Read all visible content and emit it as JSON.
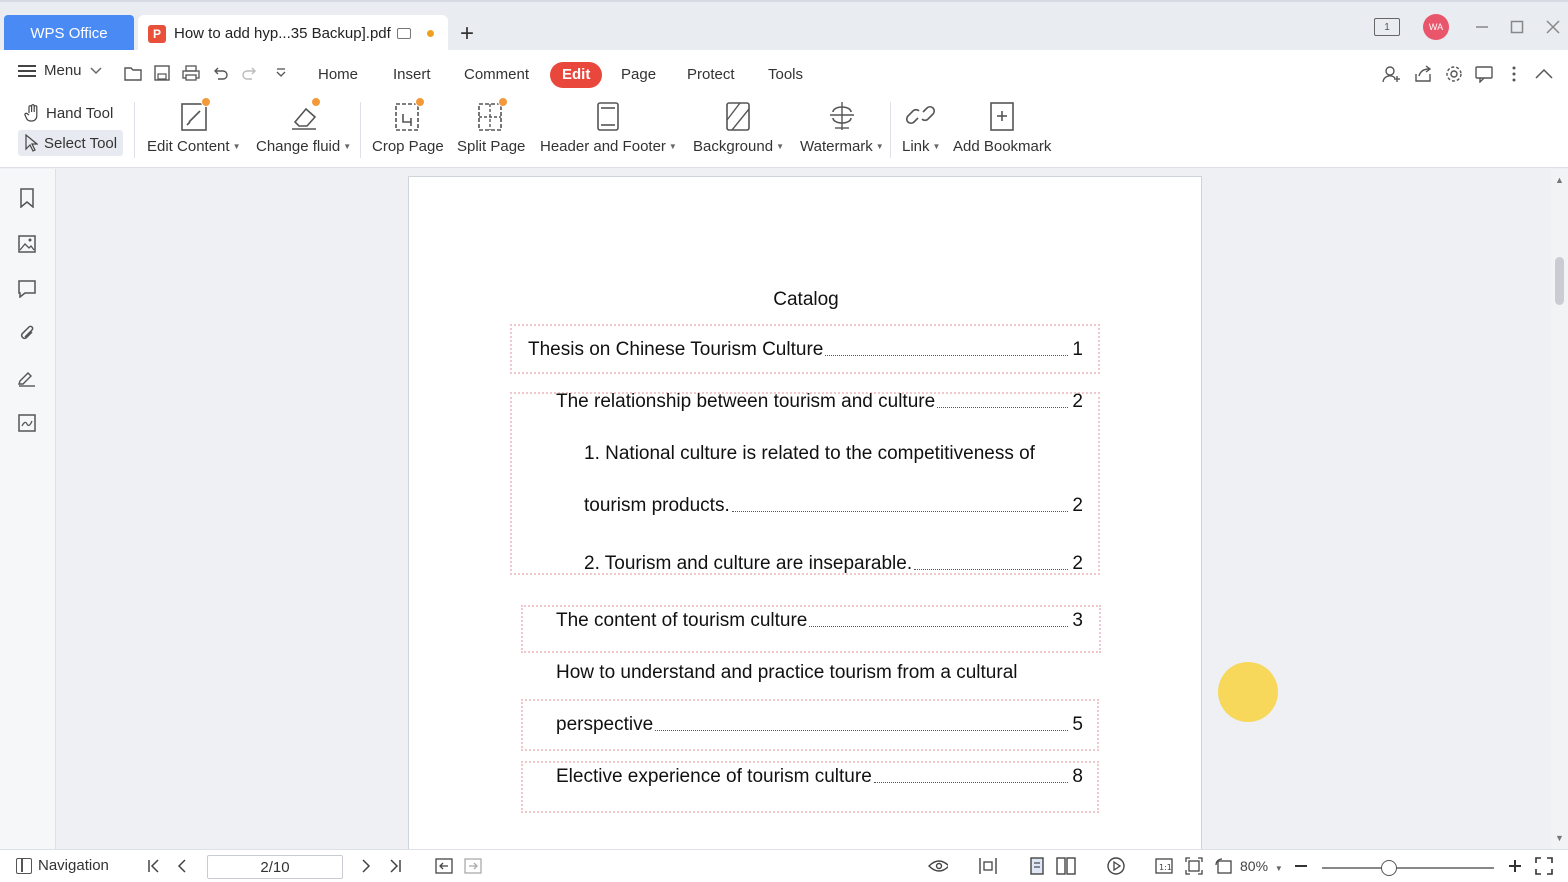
{
  "titlebar": {
    "app_tab": "WPS Office",
    "doc_tab": "How to add hyp...35 Backup].pdf",
    "avatar_initials": "WA",
    "layout_badge": "1"
  },
  "menubar": {
    "menu_label": "Menu",
    "tabs": [
      "Home",
      "Insert",
      "Comment",
      "Edit",
      "Page",
      "Protect",
      "Tools"
    ],
    "active_tab": "Edit"
  },
  "ribbon": {
    "hand_tool": "Hand Tool",
    "select_tool": "Select Tool",
    "edit_content": "Edit Content",
    "change_fluid": "Change fluid",
    "crop_page": "Crop Page",
    "split_page": "Split Page",
    "header_footer": "Header and Footer",
    "background": "Background",
    "watermark": "Watermark",
    "link": "Link",
    "add_bookmark": "Add Bookmark"
  },
  "document": {
    "catalog_title": "Catalog",
    "toc": [
      {
        "text": "Thesis on Chinese Tourism Culture",
        "page": "1"
      },
      {
        "text": "The relationship between tourism and culture",
        "page": "2"
      },
      {
        "text": "1. National culture is related to the competitiveness of",
        "page": ""
      },
      {
        "text": "tourism products.",
        "page": "2"
      },
      {
        "text": "2. Tourism and culture are inseparable.",
        "page": "2"
      },
      {
        "text": "The content of tourism culture",
        "page": "3"
      },
      {
        "text": "How to understand and practice tourism from a cultural",
        "page": ""
      },
      {
        "text": "perspective",
        "page": "5"
      },
      {
        "text": "Elective experience of tourism culture",
        "page": "8"
      }
    ]
  },
  "statusbar": {
    "navigation": "Navigation",
    "page_indicator": "2/10",
    "zoom": "80%"
  },
  "colors": {
    "accent_blue": "#4a8af4",
    "edit_tab_red": "#e9473b",
    "annotation_pink": "#f0c7cc",
    "cursor_halo": "#f7d54a"
  }
}
